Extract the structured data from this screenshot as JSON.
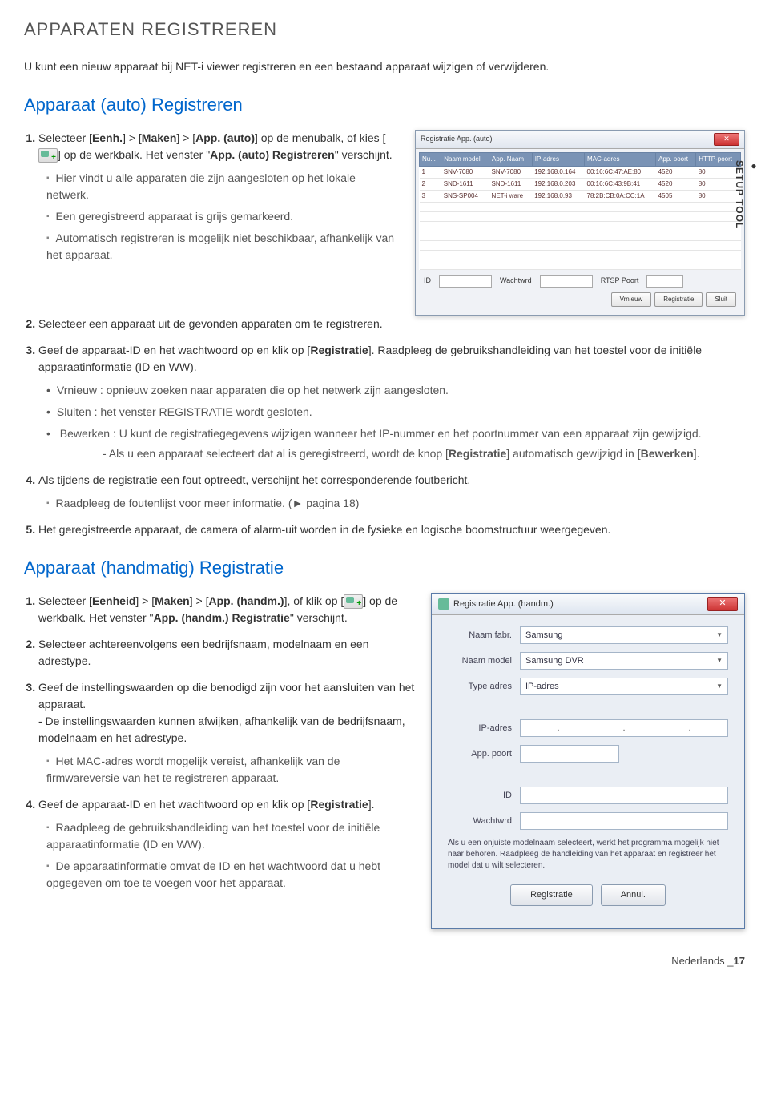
{
  "page_title": "APPARATEN REGISTREREN",
  "intro": "U kunt een nieuw apparaat bij NET-i viewer registreren en een bestaand apparaat wijzigen of verwijderen.",
  "side_tab": "SETUP TOOL",
  "section1": {
    "title": "Apparaat (auto) Registreren",
    "step1_a": "Selecteer [",
    "step1_b": "] > [",
    "step1_c": "] > [",
    "step1_d": "] op de menubalk, of kies [",
    "step1_e": "] op de werkbalk. Het venster \"",
    "step1_f": "\" verschijnt.",
    "s1_eenh": "Eenh.",
    "s1_maken": "Maken",
    "s1_app": "App. (auto)",
    "s1_window": "App. (auto) Registreren",
    "s1_sub1": "Hier vindt u alle apparaten die zijn aangesloten op het lokale netwerk.",
    "s1_sub2": "Een geregistreerd apparaat is grijs gemarkeerd.",
    "s1_sub3": "Automatisch registreren is mogelijk niet beschikbaar, afhankelijk van het apparaat.",
    "step2": "Selecteer een apparaat uit de gevonden apparaten om te registreren.",
    "step3_a": "Geef de apparaat-ID en het wachtwoord op en klik op [",
    "step3_reg": "Registratie",
    "step3_b": "]. Raadpleeg de gebruikshandleiding van het toestel voor de initiële apparaatinformatie (ID en WW).",
    "step3_sub1": "Vrnieuw : opnieuw zoeken naar apparaten die op het netwerk zijn aangesloten.",
    "step3_sub2": "Sluiten : het venster REGISTRATIE wordt gesloten.",
    "step3_sub3_a": "Bewerken : U kunt de registratiegegevens wijzigen wanneer het IP-nummer en het poortnummer van een apparaat zijn gewijzigd.",
    "step3_sub3_b1": "- Als u een apparaat selecteert dat al is geregistreerd, wordt de knop [",
    "step3_sub3_b2": "] automatisch gewijzigd in [",
    "step3_sub3_b3": "].",
    "step3_bewerken": "Bewerken",
    "step4": "Als tijdens de registratie een fout optreedt, verschijnt het corresponderende foutbericht.",
    "step4_sub": "Raadpleeg de foutenlijst voor meer informatie. (► pagina 18)",
    "step5": "Het geregistreerde apparaat, de camera of alarm-uit worden in de fysieke en logische boomstructuur weergegeven."
  },
  "dlg1": {
    "title": "Registratie App. (auto)",
    "headers": [
      "Nu...",
      "Naam model",
      "App. Naam",
      "IP-adres",
      "MAC-adres",
      "App. poort",
      "HTTP-poort"
    ],
    "rows": [
      [
        "1",
        "SNV-7080",
        "SNV-7080",
        "192.168.0.164",
        "00:16:6C:47:AE:80",
        "4520",
        "80"
      ],
      [
        "2",
        "SND-1611",
        "SND-1611",
        "192.168.0.203",
        "00:16:6C:43:9B:41",
        "4520",
        "80"
      ],
      [
        "3",
        "SNS-SP004",
        "NET-i ware",
        "192.168.0.93",
        "78:2B:CB:0A:CC:1A",
        "4505",
        "80"
      ]
    ],
    "id_label": "ID",
    "pw_label": "Wachtwrd",
    "rtsp_label": "RTSP Poort",
    "btn_refresh": "Vrnieuw",
    "btn_register": "Registratie",
    "btn_close": "Sluit"
  },
  "section2": {
    "title": "Apparaat (handmatig) Registratie",
    "step1_a": "Selecteer [",
    "step1_b": "] > [",
    "step1_c": "] > [",
    "step1_d": "], of klik op [",
    "step1_e": "] op de werkbalk. Het venster \"",
    "step1_f": "\" verschijnt.",
    "s1_eenheid": "Eenheid",
    "s1_maken": "Maken",
    "s1_app": "App. (handm.)",
    "s1_window": "App. (handm.) Registratie",
    "step2": "Selecteer achtereenvolgens een bedrijfsnaam, modelnaam en een adrestype.",
    "step3_a": "Geef de instellingswaarden op die benodigd zijn voor het aansluiten van het apparaat.",
    "step3_b": "- De instellingswaarden kunnen afwijken, afhankelijk van de bedrijfsnaam, modelnaam en het adrestype.",
    "step3_sub": "Het MAC-adres wordt mogelijk vereist, afhankelijk van de firmwareversie van het te registreren apparaat.",
    "step4_a": "Geef de apparaat-ID en het wachtwoord op en klik op [",
    "step4_reg": "Registratie",
    "step4_b": "].",
    "step4_sub1": "Raadpleeg de gebruikshandleiding van het toestel voor de initiële apparaatinformatie (ID en WW).",
    "step4_sub2": "De apparaatinformatie omvat de ID en het wachtwoord dat u hebt opgegeven om toe te voegen voor het apparaat."
  },
  "dlg2": {
    "title": "Registratie App. (handm.)",
    "lbl_fabr": "Naam fabr.",
    "lbl_model": "Naam model",
    "lbl_type": "Type adres",
    "lbl_ip": "IP-adres",
    "lbl_port": "App. poort",
    "lbl_id": "ID",
    "lbl_pw": "Wachtwrd",
    "val_fabr": "Samsung",
    "val_model": "Samsung DVR",
    "val_type": "IP-adres",
    "note": "Als u een onjuiste modelnaam selecteert, werkt het programma mogelijk niet naar behoren. Raadpleeg de handleiding van het apparaat en registreer het model dat u wilt selecteren.",
    "btn_register": "Registratie",
    "btn_cancel": "Annul."
  },
  "footer": {
    "lang": "Nederlands",
    "sep": " _",
    "page": "17"
  }
}
